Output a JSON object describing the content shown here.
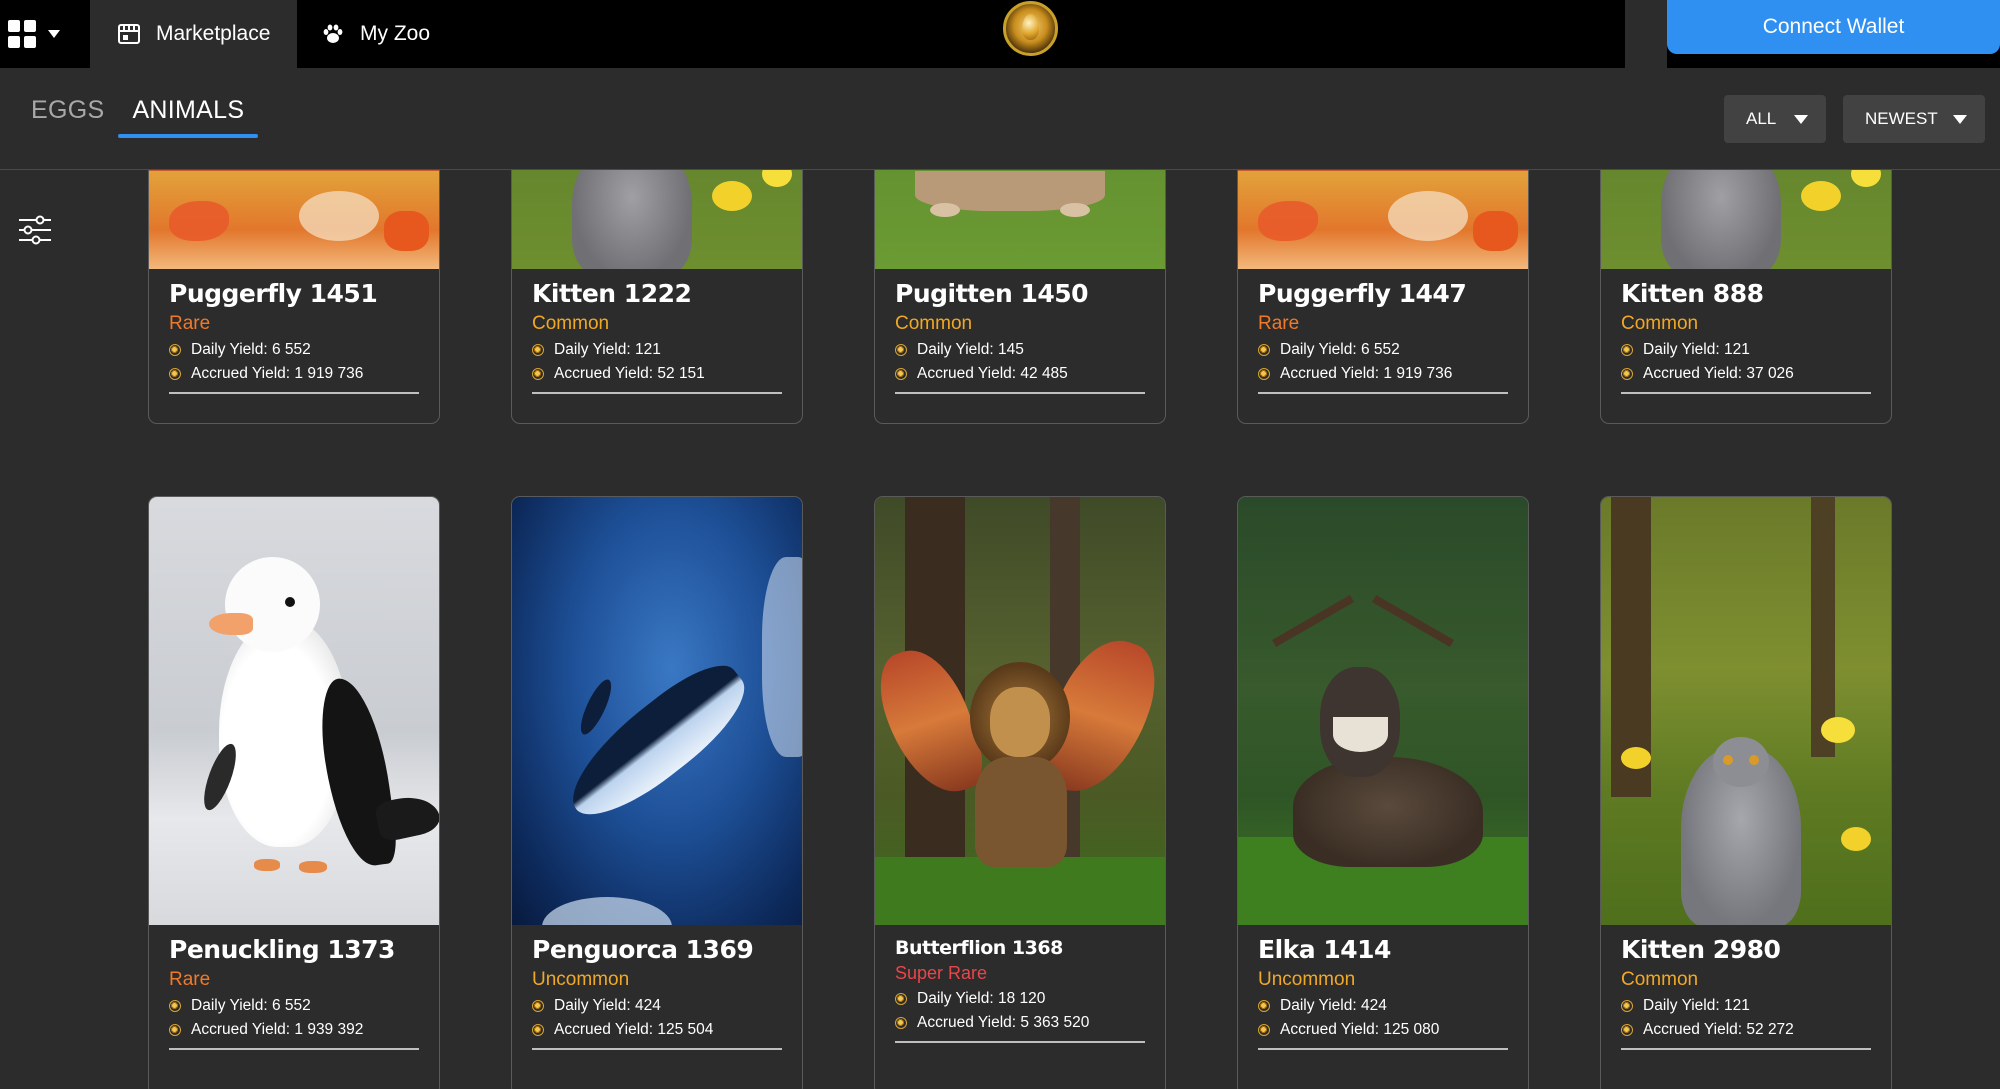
{
  "nav": {
    "app_switcher_icon": "grid-icon",
    "tabs": [
      {
        "label": "Marketplace",
        "icon": "shop-icon"
      },
      {
        "label": "My Zoo",
        "icon": "paw-icon"
      }
    ],
    "logo": "golden-egg-logo",
    "connect_label": "Connect Wallet"
  },
  "subheader": {
    "tabs": [
      {
        "label": "EGGS",
        "active": false
      },
      {
        "label": "ANIMALS",
        "active": true
      }
    ],
    "filter_all": "ALL",
    "sort_newest": "NEWEST",
    "filter_icon": "sliders-icon"
  },
  "colors": {
    "accent": "#2f90f1",
    "rare": "#f07a2a",
    "common": "#f0a826",
    "uncommon": "#f0a826",
    "super_rare": "#e8464a",
    "background": "#2c2c2c"
  },
  "cards": [
    {
      "name": "Puggerfly 1451",
      "rarity": "Rare",
      "daily": "Daily Yield: 6 552",
      "accrued": "Accrued Yield: 1 919 736"
    },
    {
      "name": "Kitten 1222",
      "rarity": "Common",
      "daily": "Daily Yield: 121",
      "accrued": "Accrued Yield: 52 151"
    },
    {
      "name": "Pugitten 1450",
      "rarity": "Common",
      "daily": "Daily Yield: 145",
      "accrued": "Accrued Yield: 42 485"
    },
    {
      "name": "Puggerfly 1447",
      "rarity": "Rare",
      "daily": "Daily Yield: 6 552",
      "accrued": "Accrued Yield: 1 919 736"
    },
    {
      "name": "Kitten 888",
      "rarity": "Common",
      "daily": "Daily Yield: 121",
      "accrued": "Accrued Yield: 37 026"
    },
    {
      "name": "Penuckling 1373",
      "rarity": "Rare",
      "daily": "Daily Yield: 6 552",
      "accrued": "Accrued Yield: 1 939 392"
    },
    {
      "name": "Penguorca 1369",
      "rarity": "Uncommon",
      "daily": "Daily Yield: 424",
      "accrued": "Accrued Yield: 125 504"
    },
    {
      "name": "Butterflion 1368",
      "rarity": "Super Rare",
      "daily": "Daily Yield: 18 120",
      "accrued": "Accrued Yield: 5 363 520"
    },
    {
      "name": "Elka 1414",
      "rarity": "Uncommon",
      "daily": "Daily Yield: 424",
      "accrued": "Accrued Yield: 125 080"
    },
    {
      "name": "Kitten 2980",
      "rarity": "Common",
      "daily": "Daily Yield: 121",
      "accrued": "Accrued Yield: 52 272"
    }
  ]
}
